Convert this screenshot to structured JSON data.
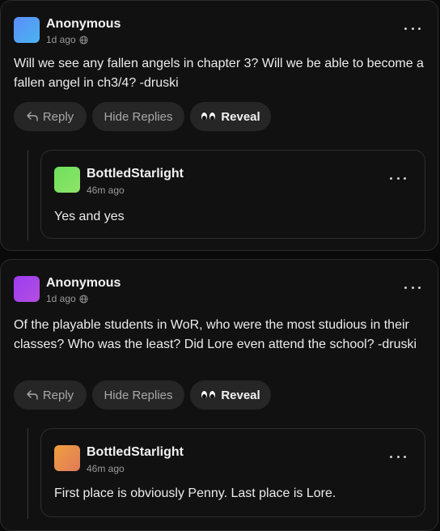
{
  "colors": {
    "avatar1": [
      "#5b8dfa",
      "#4bb4f0"
    ],
    "avatar2": [
      "#9b3cf0",
      "#b34fe0"
    ],
    "reply_avatar1": [
      "#6ee05a",
      "#8fe46a"
    ],
    "reply_avatar2": [
      "#f0a040",
      "#e07a58"
    ]
  },
  "posts": [
    {
      "author": "Anonymous",
      "time": "1d ago",
      "text": "Will we see any fallen angels in chapter 3? Will we be able to become a fallen angel in ch3/4? -druski",
      "actions": {
        "reply": "Reply",
        "hide_replies": "Hide Replies",
        "reveal": "Reveal"
      },
      "reply": {
        "author": "BottledStarlight",
        "time": "46m ago",
        "text": "Yes and yes"
      }
    },
    {
      "author": "Anonymous",
      "time": "1d ago",
      "text": "Of the playable students in WoR, who were the most studious in their classes? Who was the least? Did Lore even attend the school? -druski",
      "actions": {
        "reply": "Reply",
        "hide_replies": "Hide Replies",
        "reveal": "Reveal"
      },
      "reply": {
        "author": "BottledStarlight",
        "time": "46m ago",
        "text": "First place is obviously Penny. Last place is Lore."
      }
    }
  ]
}
